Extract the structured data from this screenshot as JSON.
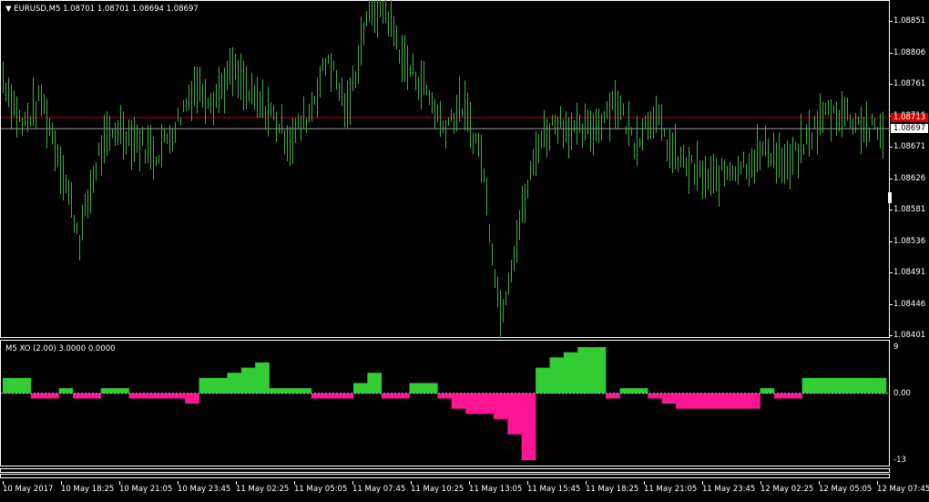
{
  "chart": {
    "header_symbol": "EURUSD,M5",
    "header_ohlc": "1.08701 1.08701 1.08694 1.08697",
    "indicator_header": "M5 XO (2.00) 3.0000 0.0000",
    "current_price": "1.08697",
    "line_price": "1.08713",
    "price_ticks": [
      "1.08851",
      "1.08806",
      "1.08761",
      "1.08716",
      "1.08671",
      "1.08626",
      "1.08581",
      "1.08536",
      "1.08491",
      "1.08446",
      "1.08401"
    ],
    "indicator_ticks": [
      "9",
      "0.00",
      "-13"
    ],
    "time_labels": [
      "10 May 2017",
      "10 May 18:25",
      "10 May 21:05",
      "10 May 23:45",
      "11 May 02:25",
      "11 May 05:05",
      "11 May 07:45",
      "11 May 10:25",
      "11 May 13:05",
      "11 May 15:45",
      "11 May 18:25",
      "11 May 21:05",
      "11 May 23:45",
      "12 May 02:25",
      "12 May 05:05",
      "12 May 07:45"
    ],
    "colors": {
      "bars": "#3cb043",
      "up": "#32cd32",
      "down": "#ff1493",
      "hline": "#c00000",
      "tag": "#d00000"
    }
  },
  "chart_data": {
    "type": "bar",
    "title": "EURUSD,M5",
    "ylim": [
      1.08401,
      1.08871
    ],
    "x": [
      "10 May 2017",
      "10 May 18:25",
      "10 May 21:05",
      "10 May 23:45",
      "11 May 02:25",
      "11 May 05:05",
      "11 May 07:45",
      "11 May 10:25",
      "11 May 13:05",
      "11 May 15:45",
      "11 May 18:25",
      "11 May 21:05",
      "11 May 23:45",
      "12 May 02:25",
      "12 May 05:05",
      "12 May 07:45"
    ],
    "price_path": [
      1.08771,
      1.087,
      1.0874,
      1.0865,
      1.0854,
      1.0866,
      1.087,
      1.0868,
      1.0866,
      1.087,
      1.0876,
      1.0874,
      1.0878,
      1.0874,
      1.0872,
      1.0868,
      1.0872,
      1.088,
      1.0872,
      1.0886,
      1.0887,
      1.0879,
      1.0876,
      1.087,
      1.0873,
      1.0866,
      1.0843,
      1.0856,
      1.0868,
      1.0871,
      1.0869,
      1.087,
      1.0874,
      1.0868,
      1.0872,
      1.0866,
      1.0864,
      1.0862,
      1.0864,
      1.0865,
      1.0867,
      1.0864,
      1.0868,
      1.0872,
      1.0872,
      1.087,
      1.0869
    ],
    "xo_values": [
      3,
      3,
      -1,
      -1,
      1,
      -1,
      -1,
      1,
      1,
      -1,
      -1,
      -1,
      -1,
      -2,
      3,
      3,
      4,
      5,
      6,
      1,
      1,
      1,
      -1,
      -1,
      -1,
      2,
      4,
      -1,
      -1,
      2,
      2,
      -1,
      -3,
      -4,
      -4,
      -5,
      -8,
      -13,
      5,
      7,
      8,
      9,
      9,
      -1,
      1,
      1,
      -1,
      -2,
      -3,
      -3,
      -3,
      -3,
      -3,
      -3,
      1,
      -1,
      -1,
      3,
      3,
      3,
      3,
      3,
      3
    ]
  }
}
